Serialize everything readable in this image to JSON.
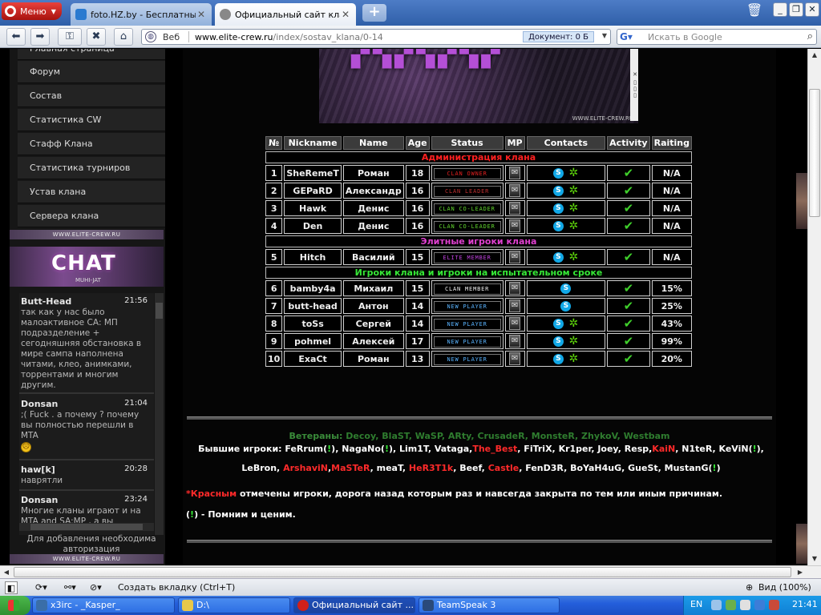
{
  "browser": {
    "menu_label": "Меню",
    "tabs": [
      {
        "label": "foto.HZ.by - Бесплатны...",
        "active": false
      },
      {
        "label": "Официальный сайт кла...",
        "active": true
      }
    ],
    "address": {
      "mode_label": "Веб",
      "url_host": "www.elite-crew.ru",
      "url_path": "/index/sostav_klana/0-14",
      "doc_size": "Документ:   0 Б"
    },
    "search_placeholder": "Искать в Google"
  },
  "sidebar": {
    "menu": [
      {
        "label": "Главная страница"
      },
      {
        "label": "Форум"
      },
      {
        "label": "Состав"
      },
      {
        "label": "Статистика CW"
      },
      {
        "label": "Стафф Клана"
      },
      {
        "label": "Статистика турниров"
      },
      {
        "label": "Устав клана"
      },
      {
        "label": "Сервера клана"
      }
    ],
    "ribbon_text": "WWW.ELITE-CREW.RU",
    "chat_banner": {
      "word": "CHAT",
      "sub": "MUHI-JAT"
    },
    "chat": [
      {
        "user": "Butt-Head",
        "time": "21:56",
        "text": "так как у нас было малоактивное СА: МП подразделение + сегодняшняя обстановка в мире сампа наполнена читами, клео, анимками, торрентами и многим другим."
      },
      {
        "user": "Donsan",
        "time": "21:04",
        "text": ";( Fuck . а почему ? почему вы полностью перешли в MTA"
      },
      {
        "user": "haw[k]",
        "time": "20:28",
        "text": "наврятли"
      },
      {
        "user": "Donsan",
        "time": "23:24",
        "text": "Многие кланы играют и на MTA and SA:MP , а вы"
      }
    ],
    "chat_note": "Для добавления необходима авторизация"
  },
  "roster": {
    "headers": [
      "№",
      "Nickname",
      "Name",
      "Age",
      "Status",
      "MP",
      "Contacts",
      "Activity",
      "Raiting"
    ],
    "sections": [
      {
        "title": "Администрация клана",
        "color": "#ff2020",
        "rows": [
          {
            "n": "1",
            "nick": "SheRemeT",
            "name": "Роман",
            "age": "18",
            "status": "CLAN OWNER",
            "status_color": "#e32020",
            "icq": true,
            "rating": "N/A"
          },
          {
            "n": "2",
            "nick": "GEPaRD",
            "name": "Александр",
            "age": "16",
            "status": "CLAN LEADER",
            "status_color": "#c03030",
            "icq": true,
            "rating": "N/A"
          },
          {
            "n": "3",
            "nick": "Hawk",
            "name": "Денис",
            "age": "16",
            "status": "CLAN CO-LEADER",
            "status_color": "#62d62f",
            "icq": true,
            "rating": "N/A"
          },
          {
            "n": "4",
            "nick": "Den",
            "name": "Денис",
            "age": "16",
            "status": "CLAN CO-LEADER",
            "status_color": "#62d62f",
            "icq": true,
            "rating": "N/A"
          }
        ]
      },
      {
        "title": "Элитные игроки клана",
        "color": "#e040d0",
        "rows": [
          {
            "n": "5",
            "nick": "Hitch",
            "name": "Василий",
            "age": "15",
            "status": "ELITE MEMBER",
            "status_color": "#c244e0",
            "icq": true,
            "rating": "N/A"
          }
        ]
      },
      {
        "title": "Игроки клана и игроки на испытательном сроке",
        "color": "#36e836",
        "rows": [
          {
            "n": "6",
            "nick": "bamby4a",
            "name": "Михаил",
            "age": "15",
            "status": "CLAN MEMBER",
            "status_color": "#f0f0f0",
            "icq": false,
            "rating": "15%"
          },
          {
            "n": "7",
            "nick": "butt-head",
            "name": "Антон",
            "age": "14",
            "status": "NEW PLAYER",
            "status_color": "#5ab4ff",
            "icq": false,
            "rating": "25%"
          },
          {
            "n": "8",
            "nick": "toSs",
            "name": "Сергей",
            "age": "14",
            "status": "NEW PLAYER",
            "status_color": "#5ab4ff",
            "icq": true,
            "rating": "43%"
          },
          {
            "n": "9",
            "nick": "pohmel",
            "name": "Алексей",
            "age": "17",
            "status": "NEW PLAYER",
            "status_color": "#5ab4ff",
            "icq": true,
            "rating": "99%"
          },
          {
            "n": "10",
            "nick": "ExaCt",
            "name": "Роман",
            "age": "13",
            "status": "NEW PLAYER",
            "status_color": "#5ab4ff",
            "icq": true,
            "rating": "20%"
          }
        ]
      }
    ]
  },
  "veterans": {
    "label": "Ветераны:",
    "names": "Decoy, BlaST, WaSP, ARty, CrusadeR, MonsteR, ZhykoV, Westbam"
  },
  "former": {
    "label": "Бывшие игроки:",
    "parts": [
      {
        "t": " FeRrum(",
        "c": ""
      },
      {
        "t": "!",
        "c": "grn"
      },
      {
        "t": "), NagaNo(",
        "c": ""
      },
      {
        "t": "!",
        "c": "grn"
      },
      {
        "t": "), Lim1T, Vataga,",
        "c": ""
      },
      {
        "t": "The_Best",
        "c": "red"
      },
      {
        "t": ", FiTriX, Kr1per, Joey, Resp,",
        "c": ""
      },
      {
        "t": "KaiN",
        "c": "red"
      },
      {
        "t": ", N1teR, KeViN(",
        "c": ""
      },
      {
        "t": "!",
        "c": "grn"
      },
      {
        "t": "),",
        "c": ""
      },
      {
        "t": "BR",
        "c": "br"
      },
      {
        "t": "LeBron, ",
        "c": ""
      },
      {
        "t": "ArshaviN",
        "c": "red"
      },
      {
        "t": ",",
        "c": ""
      },
      {
        "t": "MaSTeR",
        "c": "red"
      },
      {
        "t": ", meaT, ",
        "c": ""
      },
      {
        "t": "HeR3T1k",
        "c": "red"
      },
      {
        "t": ", Beef, ",
        "c": ""
      },
      {
        "t": "Castle",
        "c": "red"
      },
      {
        "t": ", FenD3R, BoYaH4uG, GueSt, MustanG(",
        "c": ""
      },
      {
        "t": "!",
        "c": "grn"
      },
      {
        "t": ")",
        "c": ""
      }
    ]
  },
  "notes": {
    "red_prefix": "*",
    "red_word": "Красным",
    "red_rest": " отмечены игроки, дорога назад которым раз и навсегда закрыта по тем или иным причинам.",
    "mark_open": "(",
    "mark": "!",
    "mark_rest": ") - Помним и ценим."
  },
  "statusbar": {
    "new_tab": "Создать вкладку (Ctrl+T)",
    "zoom": "Вид (100%)"
  },
  "taskbar": {
    "tasks": [
      {
        "label": "x3irc - _Kasper_",
        "icon_color": "#3a6ea8"
      },
      {
        "label": "D:\\",
        "icon_color": "#e8c84a"
      },
      {
        "label": "Официальный сайт ...",
        "icon_color": "#d0201a",
        "active": true
      },
      {
        "label": "TeamSpeak 3",
        "icon_color": "#2a4a7a"
      }
    ],
    "lang": "EN",
    "clock": "21:41"
  }
}
